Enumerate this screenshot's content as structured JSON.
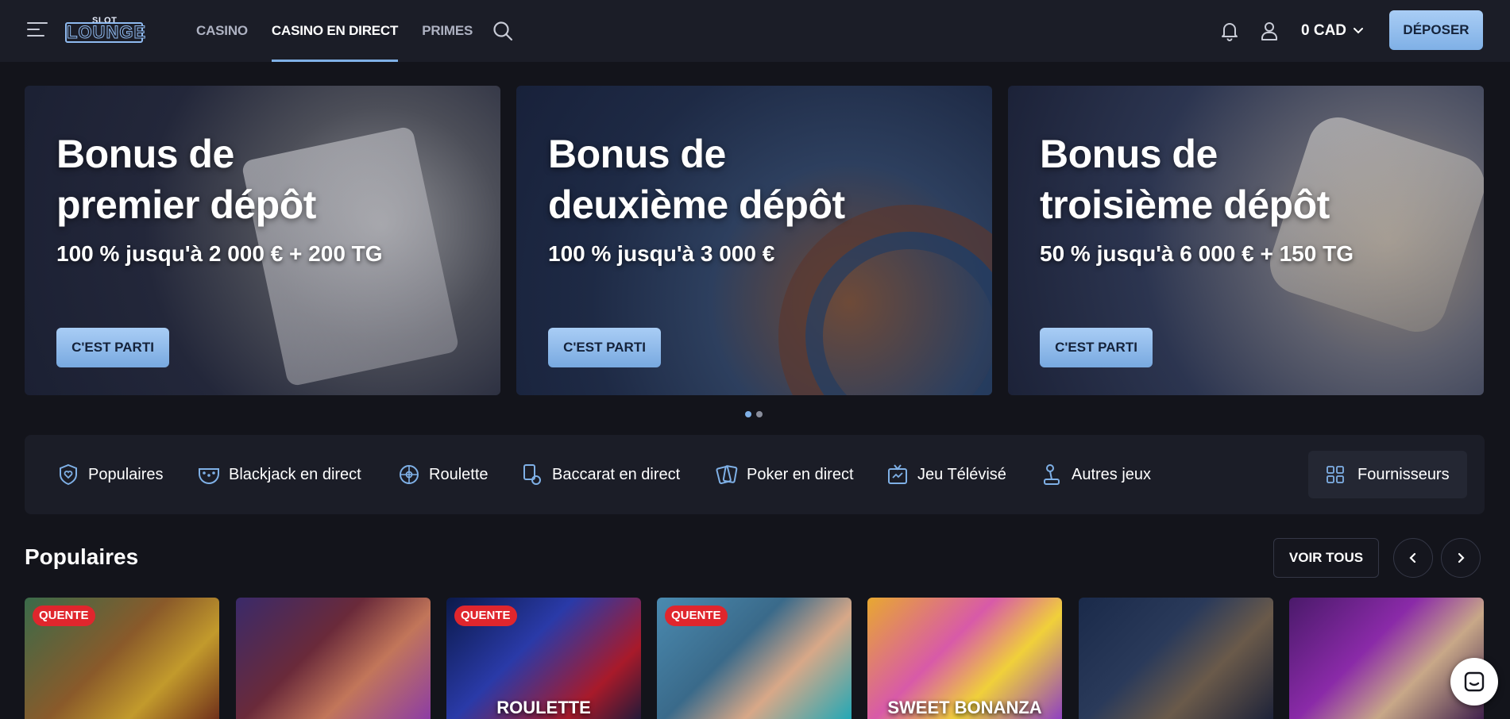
{
  "header": {
    "logo_top": "SLOT",
    "logo_main": "LOUNGE",
    "nav": [
      {
        "label": "CASINO",
        "active": false
      },
      {
        "label": "CASINO EN DIRECT",
        "active": true
      },
      {
        "label": "PRIMES",
        "active": false
      }
    ],
    "balance": "0 CAD",
    "deposit_label": "DÉPOSER"
  },
  "banners": [
    {
      "title": "Bonus de\npremier dépôt",
      "subtitle": "100 % jusqu'à 2 000 € + 200 TG",
      "cta": "C'EST PARTI"
    },
    {
      "title": "Bonus de\ndeuxième dépôt",
      "subtitle": "100 % jusqu'à 3 000 €",
      "cta": "C'EST PARTI"
    },
    {
      "title": "Bonus de\ntroisième dépôt",
      "subtitle": "50 % jusqu'à 6 000 € + 150 TG",
      "cta": "C'EST PARTI"
    }
  ],
  "carousel": {
    "pages": 2,
    "active": 1
  },
  "categories": [
    {
      "label": "Populaires",
      "icon": "heart-shield-icon"
    },
    {
      "label": "Blackjack en direct",
      "icon": "blackjack-icon"
    },
    {
      "label": "Roulette",
      "icon": "roulette-icon"
    },
    {
      "label": "Baccarat en direct",
      "icon": "baccarat-icon"
    },
    {
      "label": "Poker en direct",
      "icon": "poker-icon"
    },
    {
      "label": "Jeu Télévisé",
      "icon": "tv-icon"
    },
    {
      "label": "Autres jeux",
      "icon": "joystick-icon"
    }
  ],
  "providers_label": "Fournisseurs",
  "section": {
    "title": "Populaires",
    "see_all": "VOIR TOUS"
  },
  "tiles": [
    {
      "badge": "QUENTE",
      "name": ""
    },
    {
      "badge": "",
      "name": ""
    },
    {
      "badge": "QUENTE",
      "name": "ROULETTE"
    },
    {
      "badge": "QUENTE",
      "name": ""
    },
    {
      "badge": "",
      "name": "SWEET BONANZA"
    },
    {
      "badge": "",
      "name": ""
    },
    {
      "badge": "",
      "name": ""
    }
  ],
  "colors": {
    "accent": "#7fb0e6",
    "background": "#13141b",
    "header": "#1b1d27",
    "hot_badge": "#e0262d"
  }
}
